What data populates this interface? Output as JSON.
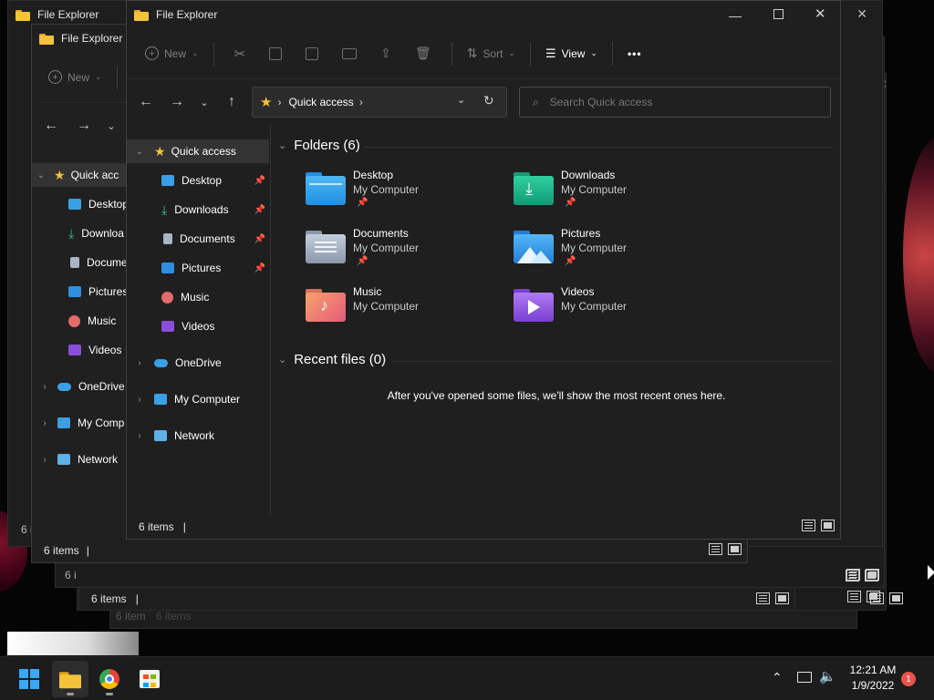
{
  "window": {
    "title": "File Explorer"
  },
  "toolbar": {
    "new_label": "New",
    "sort_label": "Sort",
    "view_label": "View",
    "more_label": "•••"
  },
  "address": {
    "location": "Quick access",
    "search_placeholder": "Search Quick access"
  },
  "nav": {
    "quick_access": "Quick access",
    "pinned": [
      {
        "label": "Desktop"
      },
      {
        "label": "Downloads"
      },
      {
        "label": "Documents"
      },
      {
        "label": "Pictures"
      }
    ],
    "music": "Music",
    "videos": "Videos",
    "onedrive": "OneDrive",
    "my_computer": "My Computer",
    "network": "Network"
  },
  "back_nav": {
    "quick_access": "Quick acc",
    "desktop": "Desktop",
    "downloads": "Downloa",
    "documents": "Docume",
    "pictures": "Pictures",
    "music": "Music",
    "videos": "Videos",
    "onedrive": "OneDrive",
    "my_computer": "My Comp",
    "network": "Network"
  },
  "folders": {
    "header": "Folders (6)",
    "items": [
      {
        "name": "Desktop",
        "location": "My Computer",
        "pinned": true
      },
      {
        "name": "Downloads",
        "location": "My Computer",
        "pinned": true
      },
      {
        "name": "Documents",
        "location": "My Computer",
        "pinned": true
      },
      {
        "name": "Pictures",
        "location": "My Computer",
        "pinned": true
      },
      {
        "name": "Music",
        "location": "My Computer",
        "pinned": false
      },
      {
        "name": "Videos",
        "location": "My Computer",
        "pinned": false
      }
    ]
  },
  "recent": {
    "header": "Recent files (0)",
    "empty_message": "After you've opened some files, we'll show the most recent ones here."
  },
  "status": {
    "item_count": "6 items",
    "item_count_trunc": "6 i",
    "item_count_faint": "6 item",
    "item_count_faint2": "6 items"
  },
  "taskbar": {
    "time": "12:21 AM",
    "date": "1/9/2022",
    "notification_count": "1"
  },
  "colors": {
    "accent": "#0078d4",
    "folder_yellow": "#f5c23b",
    "badge_red": "#e8534b"
  }
}
